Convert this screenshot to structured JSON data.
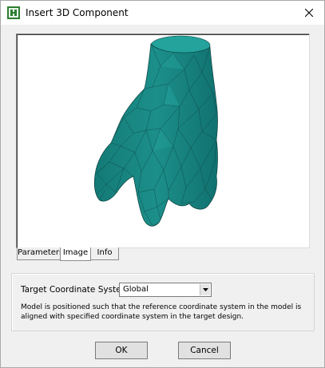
{
  "window": {
    "title": "Insert 3D Component",
    "close_glyph": "✕",
    "app_icon": "hfss-app-icon"
  },
  "tabs": [
    {
      "label": "Parameters",
      "active": false
    },
    {
      "label": "Image",
      "active": true
    },
    {
      "label": "Info",
      "active": false
    }
  ],
  "preview": {
    "model_color": "#1a8a86",
    "edge_color": "#0b3f3d"
  },
  "settings": {
    "target_coordinate_label": "Target Coordinate System:",
    "target_coordinate_value": "Global",
    "description": "Model is positioned such that the reference coordinate system in the model is aligned with specified coordinate system in the target design."
  },
  "buttons": {
    "ok": "OK",
    "cancel": "Cancel"
  }
}
